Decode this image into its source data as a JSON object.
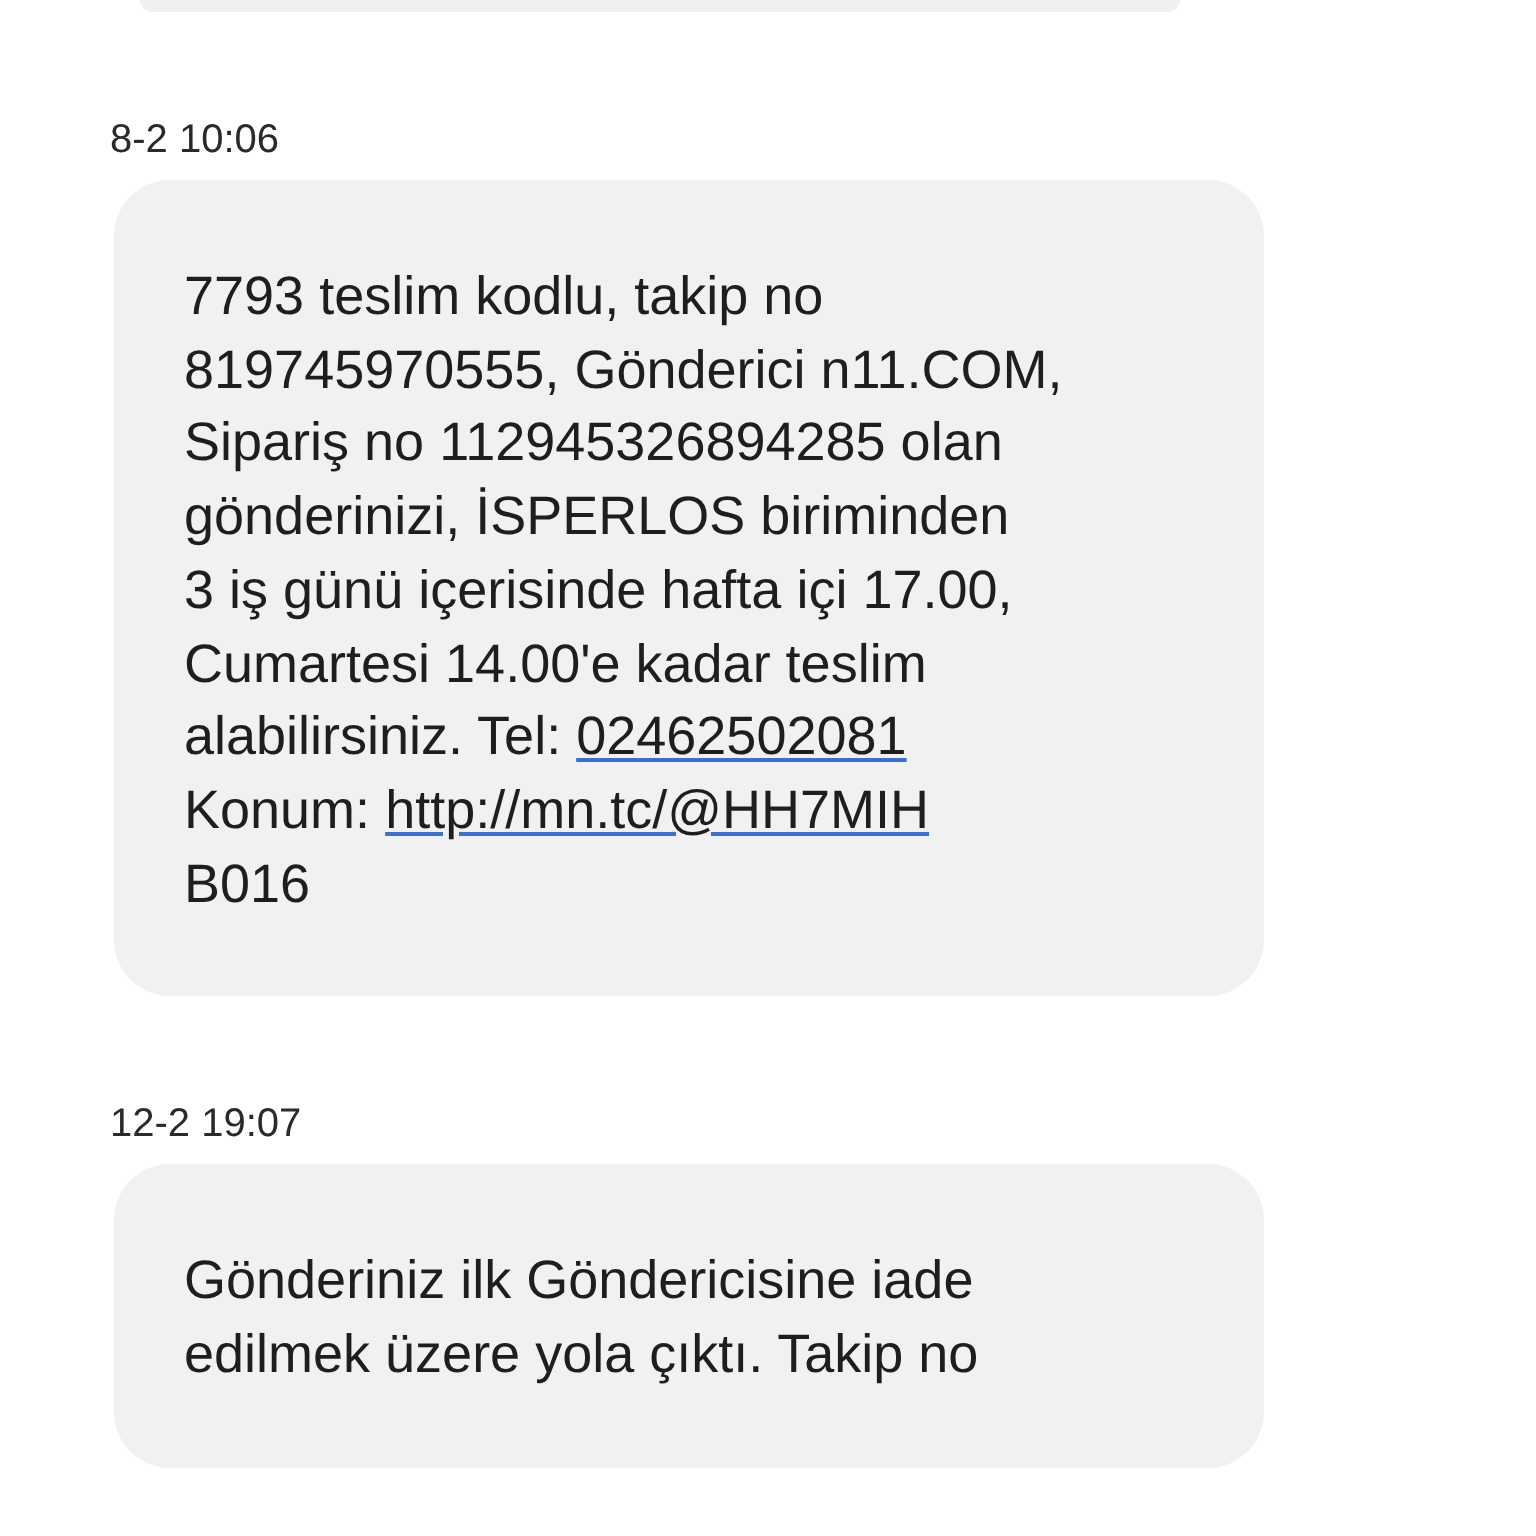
{
  "messages": [
    {
      "time": "8-2 10:06",
      "parts": [
        {
          "kind": "text",
          "text": "7793 teslim kodlu, takip no\n819745970555, Gönderici n11.COM,\nSipariş no 112945326894285 olan\ngönderinizi, İSPERLOS biriminden\n3 iş günü içerisinde hafta içi 17.00,\nCumartesi 14.00'e kadar teslim\nalabilirsiniz. Tel: "
        },
        {
          "kind": "link",
          "text": "02462502081"
        },
        {
          "kind": "text",
          "text": "\nKonum: "
        },
        {
          "kind": "link",
          "text": "http://mn.tc/@HH7MIH"
        },
        {
          "kind": "text",
          "text": "\nB016"
        }
      ]
    },
    {
      "time": "12-2 19:07",
      "parts": [
        {
          "kind": "text",
          "text": "Gönderiniz ilk Göndericisine iade\nedilmek üzere yola çıktı. Takip no"
        }
      ]
    }
  ]
}
